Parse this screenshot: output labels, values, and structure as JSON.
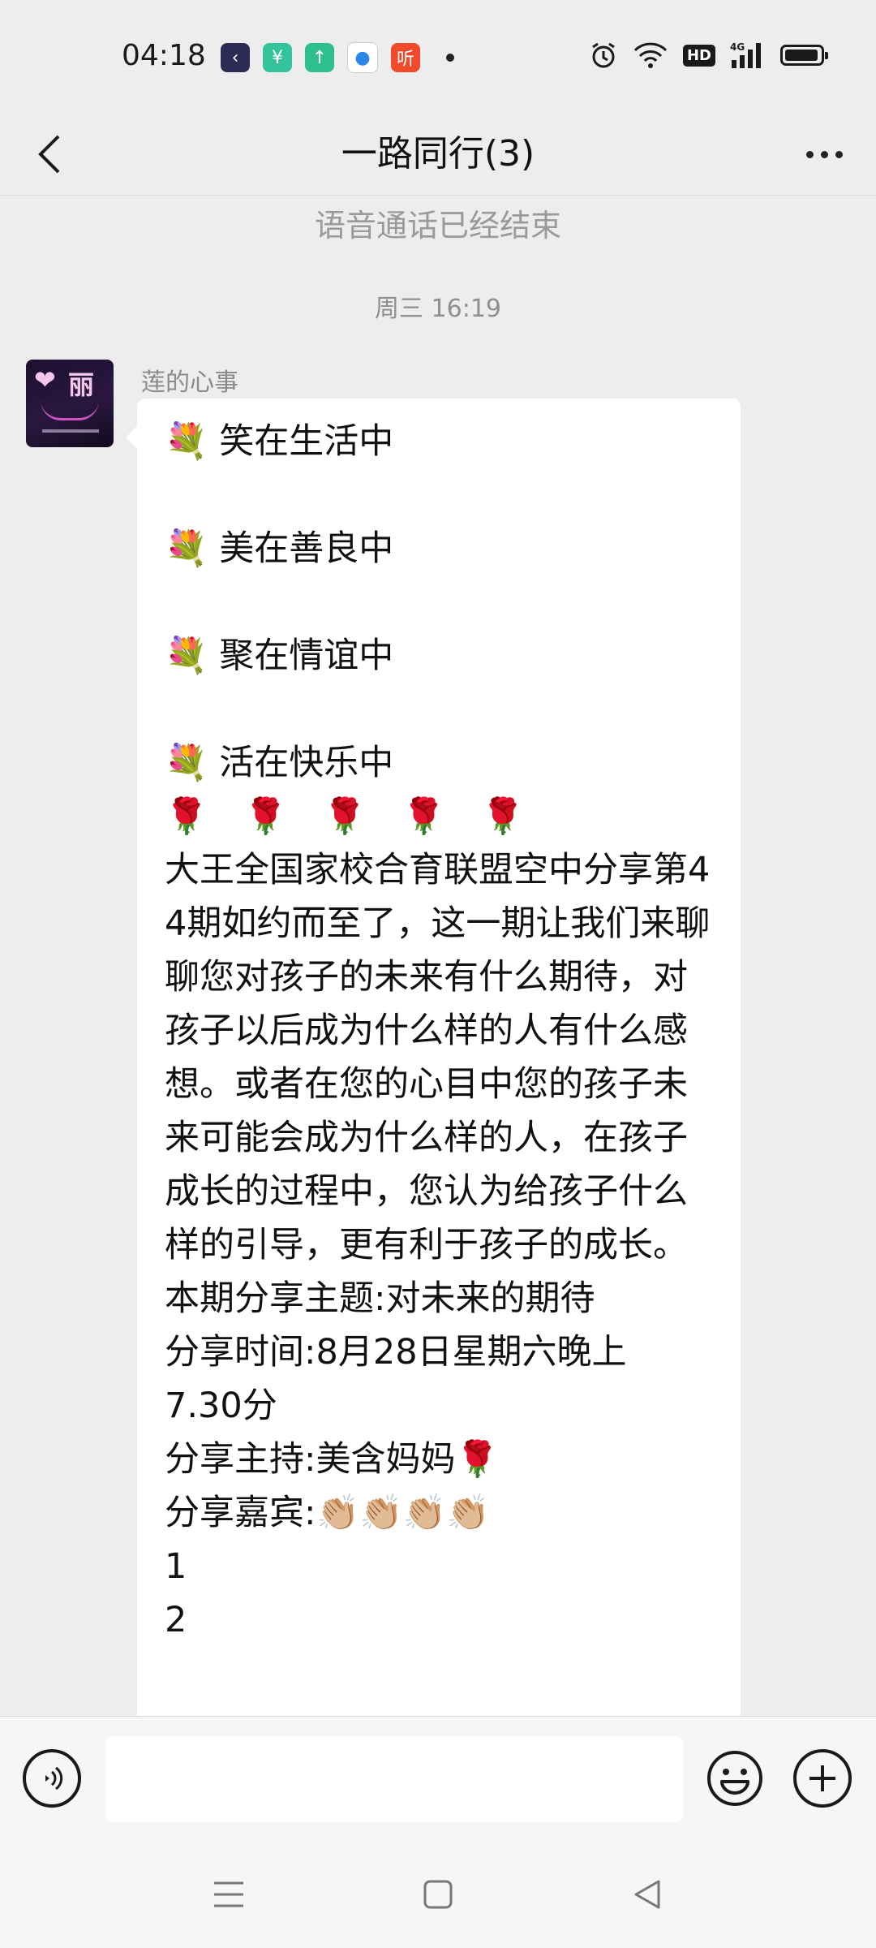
{
  "status_bar": {
    "time": "04:18",
    "notification_icons": [
      {
        "name": "app-back-icon",
        "color": "#2b2b55",
        "glyph": "‹"
      },
      {
        "name": "app-green-icon",
        "color": "#34c39a",
        "glyph": "¥"
      },
      {
        "name": "app-upload-icon",
        "color": "#2fbf8f",
        "glyph": "↑"
      },
      {
        "name": "app-blue-dot-icon",
        "color": "#ffffff",
        "glyph": "●"
      },
      {
        "name": "app-listen-icon",
        "color": "#f04a2a",
        "glyph": "听"
      }
    ],
    "network_label": "4G",
    "hd_label": "HD",
    "battery_level": 0.95
  },
  "header": {
    "title": "一路同行(3)"
  },
  "chat": {
    "system_message": "语音通话已经结束",
    "timestamp": "周三 16:19",
    "message": {
      "sender": "莲的心事",
      "avatar_text": "丽",
      "avatar_heart": "❤",
      "lines": [
        "💐 笑在生活中",
        "",
        "💐 美在善良中",
        "",
        "💐 聚在情谊中",
        "",
        "💐 活在快乐中",
        "🌹🌹🌹🌹🌹"
      ],
      "paragraph": "大王全国家校合育联盟空中分享第44期如约而至了，这一期让我们来聊聊您对孩子的未来有什么期待，对孩子以后成为什么样的人有什么感想。或者在您的心目中您的孩子未来可能会成为什么样的人，在孩子成长的过程中，您认为给孩子什么样的引导，更有利于孩子的成长。",
      "theme": "本期分享主题:对未来的期待",
      "time_line1": "分享时间:8月28日星期六晚上",
      "time_line2": "7.30分",
      "host": "分享主持:美含妈妈🌹",
      "guests": "分享嘉宾:👏🏼👏🏼👏🏼👏🏼",
      "list": [
        "1",
        "2"
      ]
    }
  },
  "input": {
    "placeholder": ""
  }
}
